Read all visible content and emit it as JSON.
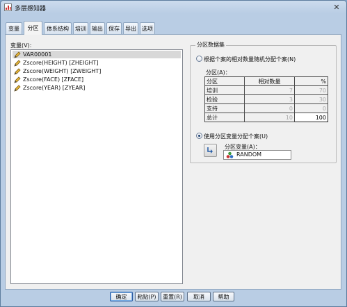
{
  "window": {
    "title": "多层感知器"
  },
  "tabs": [
    "变量",
    "分区",
    "体系结构",
    "培训",
    "输出",
    "保存",
    "导出",
    "选项"
  ],
  "variables": {
    "label": "变量(V):",
    "items": [
      "VAR00001",
      "Zscore(HEIGHT) [ZHEIGHT]",
      "Zscore(WEIGHT) [ZWEIGHT]",
      "Zscore(FACE) [ZFACE]",
      "Zscore(YEAR) [ZYEAR]"
    ]
  },
  "partition": {
    "group_title": "分区数据集",
    "option1_label": "根据个案的相对数量随机分配个案(N)",
    "table_label": "分区(A)：",
    "headers": [
      "分区",
      "相对数量",
      "%"
    ],
    "rows": [
      [
        "培训",
        "7",
        "70"
      ],
      [
        "检验",
        "3",
        "30"
      ],
      [
        "支持",
        "0",
        "0"
      ],
      [
        "总计",
        "10",
        "100"
      ]
    ],
    "option2_label": "使用分区变量分配个案(U)",
    "split_var_label": "分区变量(A)：",
    "split_var_value": "RANDOM"
  },
  "buttons": {
    "ok": "确定",
    "paste": "粘贴(P)",
    "reset": "重置(R)",
    "cancel": "取消",
    "help": "帮助"
  }
}
